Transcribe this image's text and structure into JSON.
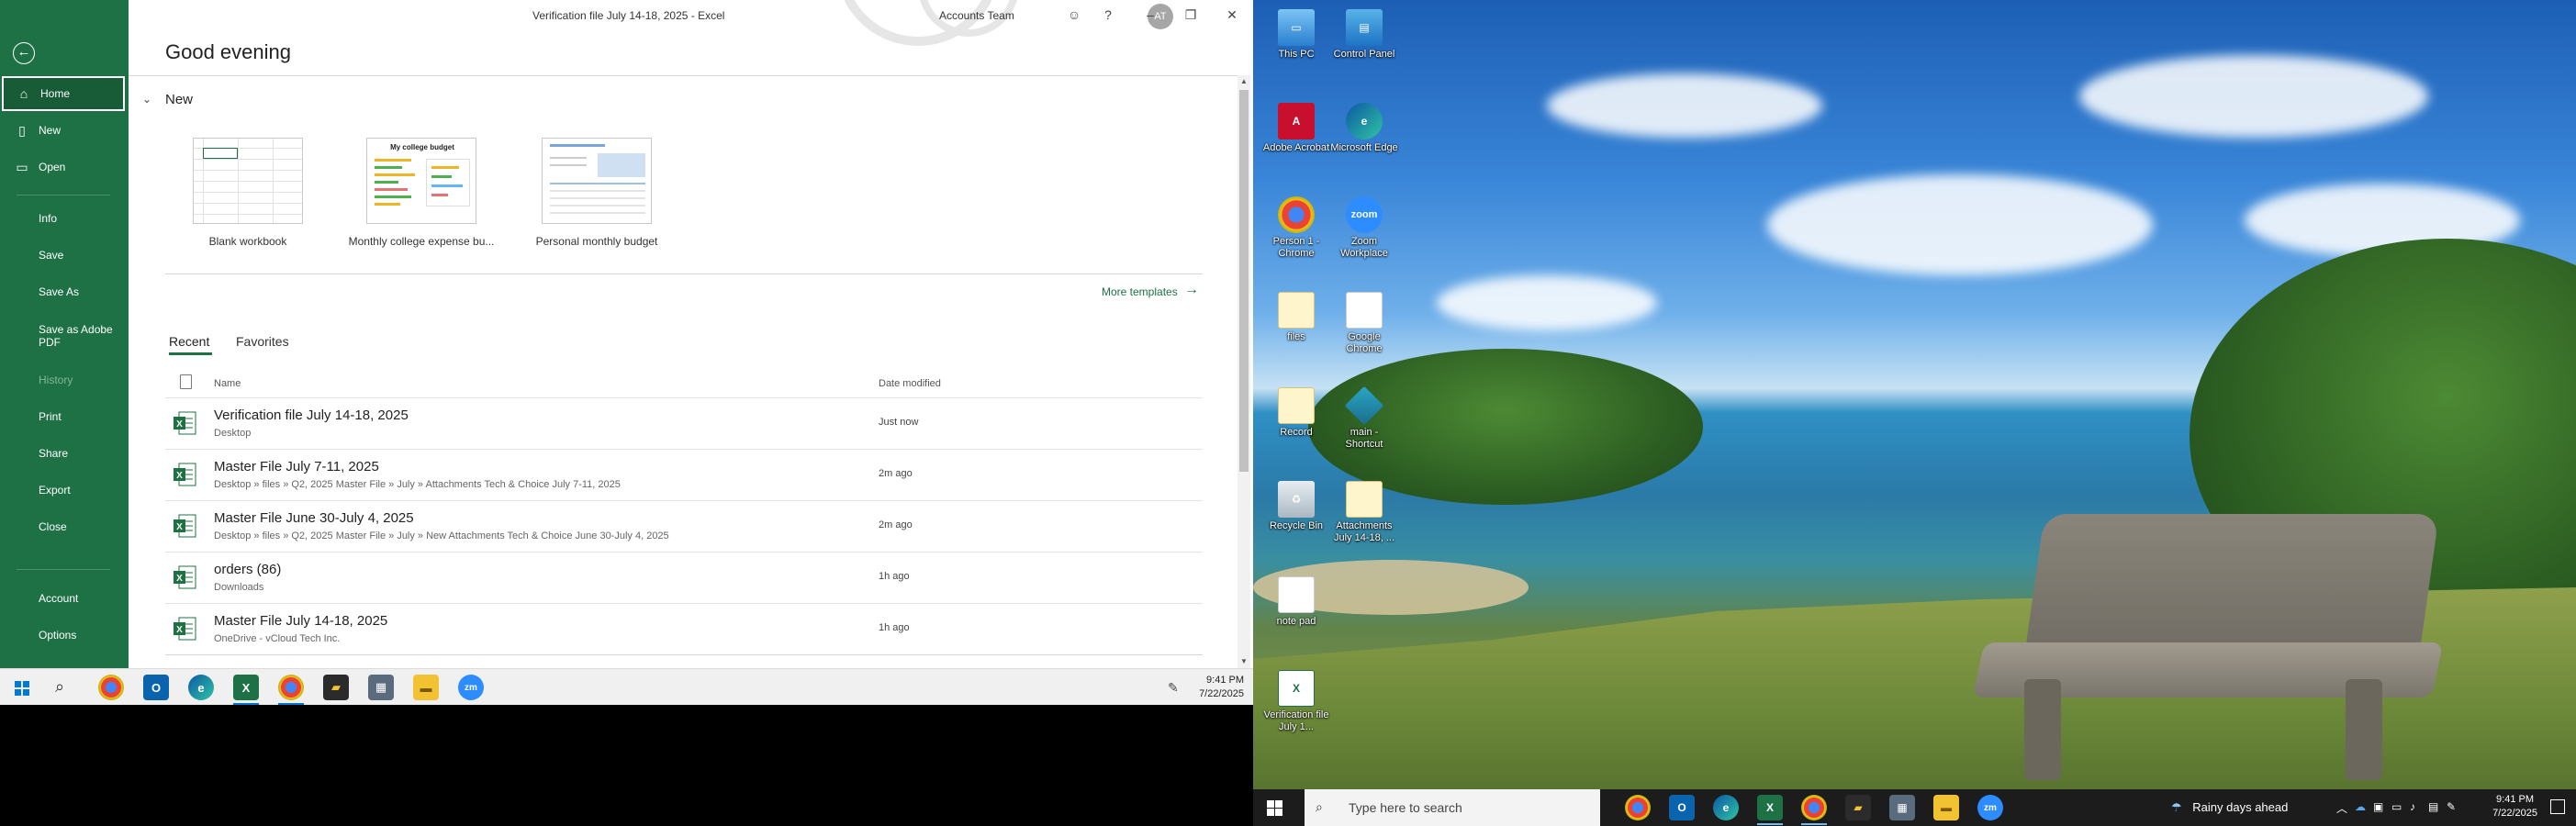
{
  "excel": {
    "window_title": "Verification file July 14-18, 2025  -  Excel",
    "account_name": "Accounts Team",
    "account_initials": "AT",
    "titlebar_icons": [
      "feedback-icon",
      "help-icon",
      "minimize-icon",
      "restore-icon",
      "close-icon"
    ],
    "greeting": "Good evening",
    "nav": {
      "home": "Home",
      "new": "New",
      "open": "Open",
      "info": "Info",
      "save": "Save",
      "save_as": "Save As",
      "save_as_pdf": "Save as Adobe PDF",
      "history": "History",
      "print": "Print",
      "share": "Share",
      "export": "Export",
      "close": "Close",
      "account": "Account",
      "options": "Options"
    },
    "new_section": {
      "title": "New",
      "templates": [
        {
          "label": "Blank workbook"
        },
        {
          "label": "Monthly college expense bu...",
          "thumb_title": "My college budget"
        },
        {
          "label": "Personal monthly budget"
        }
      ],
      "more_templates": "More templates"
    },
    "tabs": [
      "Recent",
      "Favorites"
    ],
    "columns": {
      "name": "Name",
      "date": "Date modified"
    },
    "files": [
      {
        "name": "Verification file July 14-18, 2025",
        "path": "Desktop",
        "date": "Just now"
      },
      {
        "name": "Master File July 7-11, 2025",
        "path": "Desktop » files » Q2, 2025 Master File » July » Attachments  Tech & Choice July 7-11, 2025",
        "date": "2m ago"
      },
      {
        "name": "Master File June 30-July 4, 2025",
        "path": "Desktop » files » Q2, 2025 Master File » July » New Attachments Tech & Choice June 30-July 4, 2025",
        "date": "2m ago"
      },
      {
        "name": "orders (86)",
        "path": "Downloads",
        "date": "1h ago"
      },
      {
        "name": "Master File July 14-18, 2025",
        "path": "OneDrive - vCloud Tech Inc.",
        "date": "1h ago"
      }
    ]
  },
  "left_taskbar": {
    "time": "9:41 PM",
    "date": "7/22/2025"
  },
  "desktop": {
    "icons": [
      {
        "label": "This PC"
      },
      {
        "label": "Control Panel"
      },
      {
        "label": "Adobe Acrobat"
      },
      {
        "label": "Microsoft Edge"
      },
      {
        "label": "Person 1 - Chrome"
      },
      {
        "label": "Zoom Workplace",
        "glyph": "zoom"
      },
      {
        "label": "files"
      },
      {
        "label": "Google Chrome"
      },
      {
        "label": "Record"
      },
      {
        "label": "main - Shortcut"
      },
      {
        "label": "Recycle Bin"
      },
      {
        "label": "Attachments July 14-18, ..."
      },
      {
        "label": "note pad"
      },
      {
        "label": "Verification file July 1..."
      }
    ]
  },
  "right_taskbar": {
    "search_placeholder": "Type here to search",
    "weather": "Rainy days ahead",
    "time": "9:41 PM",
    "date": "7/22/2025"
  },
  "colors": {
    "excel_green": "#1e7145",
    "excel_green_dark": "#185c37",
    "taskbar_dark": "#1c1c1c"
  }
}
